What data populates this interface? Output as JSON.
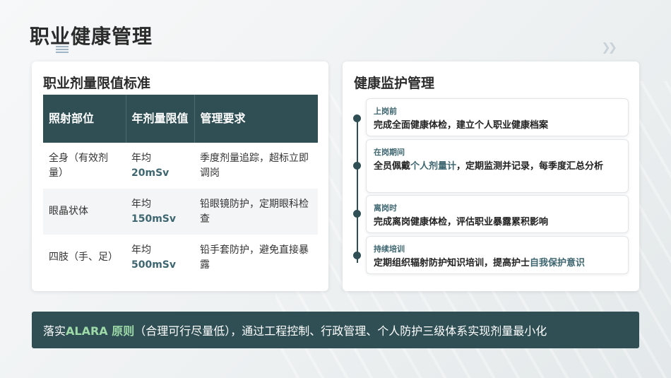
{
  "page": {
    "title": "职业健康管理"
  },
  "left_card": {
    "title": "职业剂量限值标准",
    "headers": [
      "照射部位",
      "年剂量限值",
      "管理要求"
    ],
    "rows": [
      {
        "part": "全身（有效剂量）",
        "prefix": "年均",
        "value": "20mSv",
        "req": "季度剂量追踪，超标立即调岗"
      },
      {
        "part": "眼晶状体",
        "prefix": "年均",
        "value": "150mSv",
        "req": "铅眼镜防护，定期眼科检查"
      },
      {
        "part": "四肢（手、足）",
        "prefix": "年均",
        "value": "500mSv",
        "req": "铅手套防护，避免直接暴露"
      }
    ]
  },
  "right_card": {
    "title": "健康监护管理",
    "items": [
      {
        "label": "上岗前",
        "text": "完成全面健康体检，建立个人职业健康档案"
      },
      {
        "label": "在岗期间",
        "text_a": "全员佩戴",
        "text_accent": "个人剂量计",
        "text_b": "，定期监测并记录，每季度汇总分析"
      },
      {
        "label": "离岗时",
        "text": "完成离岗健康体检，评估职业暴露累积影响"
      },
      {
        "label": "持续培训",
        "text_a": "定期组织辐射防护知识培训，提高护士",
        "text_accent": "自我保护意识"
      }
    ]
  },
  "banner": {
    "prefix": "落实 ",
    "highlight": "ALARA 原则",
    "suffix": "（合理可行尽量低），通过工程控制、行政管理、个人防护三级体系实现剂量最小化"
  },
  "colors": {
    "primary": "#2f4f54",
    "accent": "#3e6670",
    "banner_highlight": "#9ed9a8"
  }
}
